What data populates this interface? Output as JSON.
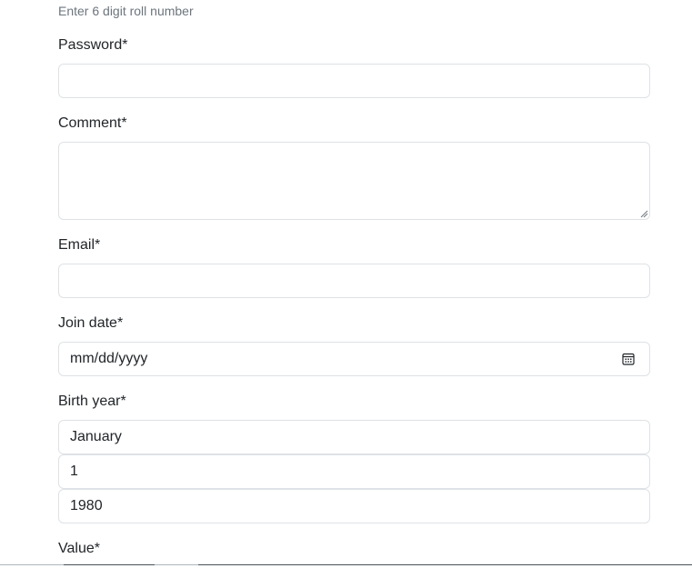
{
  "roll_help": "Enter 6 digit roll number",
  "password": {
    "label": "Password*",
    "value": ""
  },
  "comment": {
    "label": "Comment*",
    "value": ""
  },
  "email": {
    "label": "Email*",
    "value": ""
  },
  "join_date": {
    "label": "Join date*",
    "placeholder": "mm/dd/yyyy",
    "icon": "calendar-icon"
  },
  "birth_year": {
    "label": "Birth year*",
    "month": "January",
    "day": "1",
    "year": "1980"
  },
  "value": {
    "label": "Value*"
  }
}
